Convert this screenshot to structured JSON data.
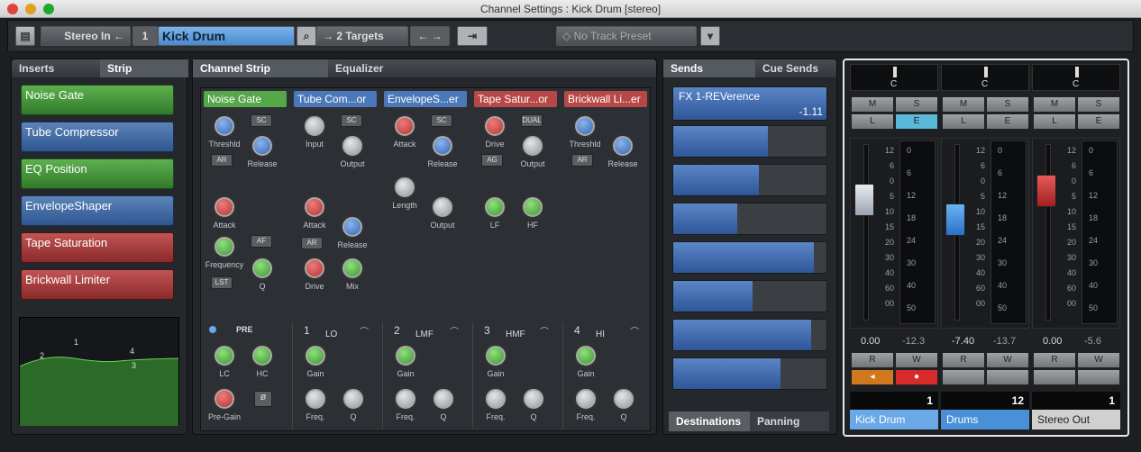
{
  "window": {
    "title": "Channel Settings : Kick Drum [stereo]"
  },
  "toolbar": {
    "input": "Stereo In",
    "index": "1",
    "channel_name": "Kick Drum",
    "targets": "2 Targets",
    "preset": "No Track Preset"
  },
  "inserts_panel": {
    "tab_inserts": "Inserts",
    "tab_strip": "Strip",
    "slots": [
      "Noise Gate",
      "Tube Compressor",
      "EQ Position",
      "EnvelopeShaper",
      "Tape Saturation",
      "Brickwall Limiter"
    ],
    "eq_points": [
      "2",
      "1",
      "4",
      "3"
    ]
  },
  "strip_panel": {
    "tab_channel_strip": "Channel Strip",
    "tab_equalizer": "Equalizer",
    "modules": [
      {
        "title": "Noise Gate",
        "labels": [
          "Threshld",
          "Release",
          "Attack",
          "Frequency",
          "Q"
        ],
        "buttons": [
          "SC",
          "AR",
          "AF",
          "LST"
        ]
      },
      {
        "title": "Tube Com...or",
        "labels": [
          "Input",
          "Output",
          "Attack",
          "Release",
          "Drive",
          "Mix"
        ],
        "buttons": [
          "SC",
          "AR"
        ]
      },
      {
        "title": "EnvelopeS...er",
        "labels": [
          "Attack",
          "Release",
          "Length",
          "Output"
        ],
        "buttons": [
          "SC"
        ]
      },
      {
        "title": "Tape Satur...or",
        "labels": [
          "Drive",
          "Output",
          "LF",
          "HF"
        ],
        "buttons": [
          "DUAL",
          "AG"
        ]
      },
      {
        "title": "Brickwall Li...er",
        "labels": [
          "Threshld",
          "Release"
        ],
        "buttons": [
          "AR"
        ]
      }
    ],
    "eq": {
      "pre": "PRE",
      "pre_labels": [
        "LC",
        "HC",
        "Pre-Gain"
      ],
      "phase": "ø",
      "bands": [
        {
          "num": "1",
          "name": "LO"
        },
        {
          "num": "2",
          "name": "LMF"
        },
        {
          "num": "3",
          "name": "HMF"
        },
        {
          "num": "4",
          "name": "HI"
        }
      ],
      "band_labels": [
        "Gain",
        "Freq.",
        "Q"
      ]
    }
  },
  "sends_panel": {
    "tab_sends": "Sends",
    "tab_cue": "Cue Sends",
    "first_send": {
      "name": "FX 1-REVerence",
      "value": "-1.11"
    },
    "send_levels": [
      0.62,
      0.56,
      0.42,
      0.92,
      0.52,
      0.9,
      0.7
    ],
    "tab_destinations": "Destinations",
    "tab_panning": "Panning"
  },
  "mixer": {
    "channels": [
      {
        "pan": "C",
        "m": "M",
        "s": "S",
        "l": "L",
        "e": "E",
        "level": "0.00",
        "peak": "-12.3",
        "r": "R",
        "w": "W",
        "number": "1",
        "name": "Kick Drum",
        "color": "#6aa8e6"
      },
      {
        "pan": "C",
        "m": "M",
        "s": "S",
        "l": "L",
        "e": "E",
        "level": "-7.40",
        "peak": "-13.7",
        "r": "R",
        "w": "W",
        "number": "12",
        "name": "Drums",
        "color": "#4a90d9"
      },
      {
        "pan": "C",
        "m": "M",
        "s": "S",
        "l": "L",
        "e": "E",
        "level": "0.00",
        "peak": "-5.6",
        "r": "R",
        "w": "W",
        "number": "1",
        "name": "Stereo Out",
        "color": "#d0d0d0"
      }
    ],
    "fader_scale": [
      "12",
      "6",
      "0",
      "5",
      "10",
      "15",
      "20",
      "30",
      "40",
      "60",
      "00"
    ],
    "meter_scale": [
      "0",
      "6",
      "12",
      "18",
      "24",
      "30",
      "40",
      "50"
    ]
  }
}
